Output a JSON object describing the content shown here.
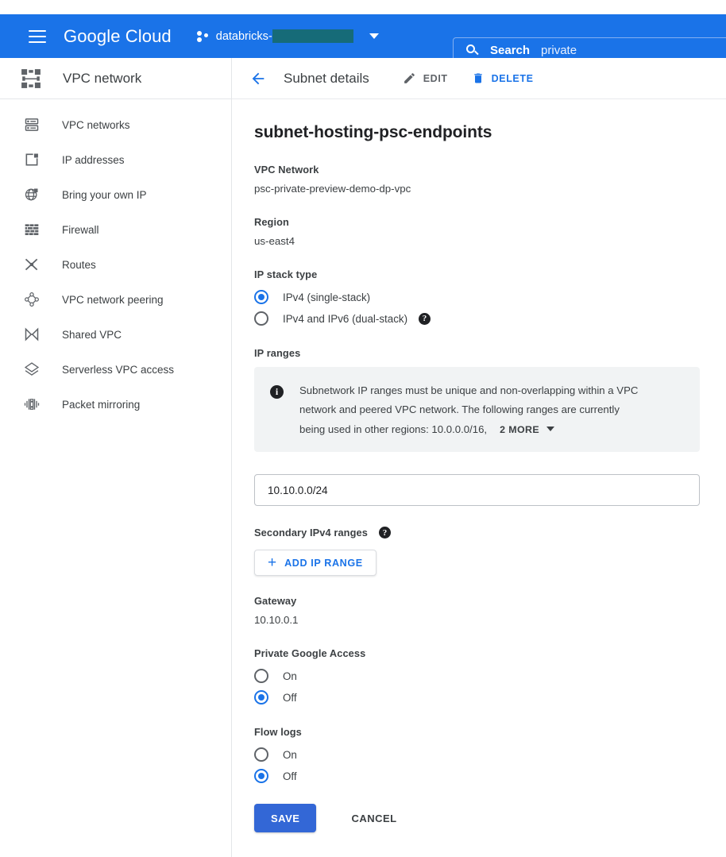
{
  "topbar": {
    "menu_icon": "hamburger-menu-icon",
    "brand": "Google Cloud",
    "project_icon": "project-selector-icon",
    "project_name": "databricks-",
    "project_redacted": true,
    "dropdown_icon": "chevron-down-icon",
    "search": {
      "icon": "search-icon",
      "label": "Search",
      "value": "private"
    },
    "bg_color": "#1a73e8"
  },
  "sidebar": {
    "header": {
      "icon": "vpc-network-icon",
      "title": "VPC network"
    },
    "items": [
      {
        "label": "VPC networks",
        "icon": "vpc-networks-icon"
      },
      {
        "label": "IP addresses",
        "icon": "ip-addresses-icon"
      },
      {
        "label": "Bring your own IP",
        "icon": "bring-your-own-ip-icon"
      },
      {
        "label": "Firewall",
        "icon": "firewall-icon"
      },
      {
        "label": "Routes",
        "icon": "routes-icon"
      },
      {
        "label": "VPC network peering",
        "icon": "vpc-network-peering-icon"
      },
      {
        "label": "Shared VPC",
        "icon": "shared-vpc-icon"
      },
      {
        "label": "Serverless VPC access",
        "icon": "serverless-vpc-access-icon"
      },
      {
        "label": "Packet mirroring",
        "icon": "packet-mirroring-icon"
      }
    ]
  },
  "main": {
    "back_icon": "back-arrow-icon",
    "header_title": "Subnet details",
    "actions": [
      {
        "label": "EDIT",
        "icon": "pencil-icon",
        "color": "#5f6368"
      },
      {
        "label": "DELETE",
        "icon": "trash-icon",
        "color": "#1a73e8"
      }
    ],
    "page_title": "subnet-hosting-psc-endpoints",
    "vpc_network": {
      "label": "VPC Network",
      "value": "psc-private-preview-demo-dp-vpc"
    },
    "region": {
      "label": "Region",
      "value": "us-east4"
    },
    "ip_stack_type": {
      "label": "IP stack type",
      "options": [
        {
          "label": "IPv4 (single-stack)",
          "selected": true,
          "help": false
        },
        {
          "label": "IPv4 and IPv6 (dual-stack)",
          "selected": false,
          "help": true
        }
      ],
      "help_icon": "help-icon"
    },
    "ip_ranges": {
      "label": "IP ranges",
      "info_icon": "info-icon",
      "info_text_line1": "Subnetwork IP ranges must be unique and non-overlapping within a VPC",
      "info_text_line2": "network and peered VPC network. The following ranges are currently",
      "info_text_line3": "being used in other regions: 10.0.0.0/16,",
      "more_label": "2 MORE",
      "more_icon": "chevron-down-icon",
      "input_value": "10.10.0.0/24"
    },
    "secondary_ranges": {
      "label": "Secondary IPv4 ranges",
      "help_icon": "help-icon",
      "add_button": {
        "label": "ADD IP RANGE",
        "icon": "plus-icon"
      }
    },
    "gateway": {
      "label": "Gateway",
      "value": "10.10.0.1"
    },
    "private_google_access": {
      "label": "Private Google Access",
      "options": [
        {
          "label": "On",
          "selected": false
        },
        {
          "label": "Off",
          "selected": true
        }
      ]
    },
    "flow_logs": {
      "label": "Flow logs",
      "options": [
        {
          "label": "On",
          "selected": false
        },
        {
          "label": "Off",
          "selected": true
        }
      ]
    },
    "footer": {
      "save_label": "SAVE",
      "cancel_label": "CANCEL",
      "save_color": "#3367d6"
    }
  }
}
